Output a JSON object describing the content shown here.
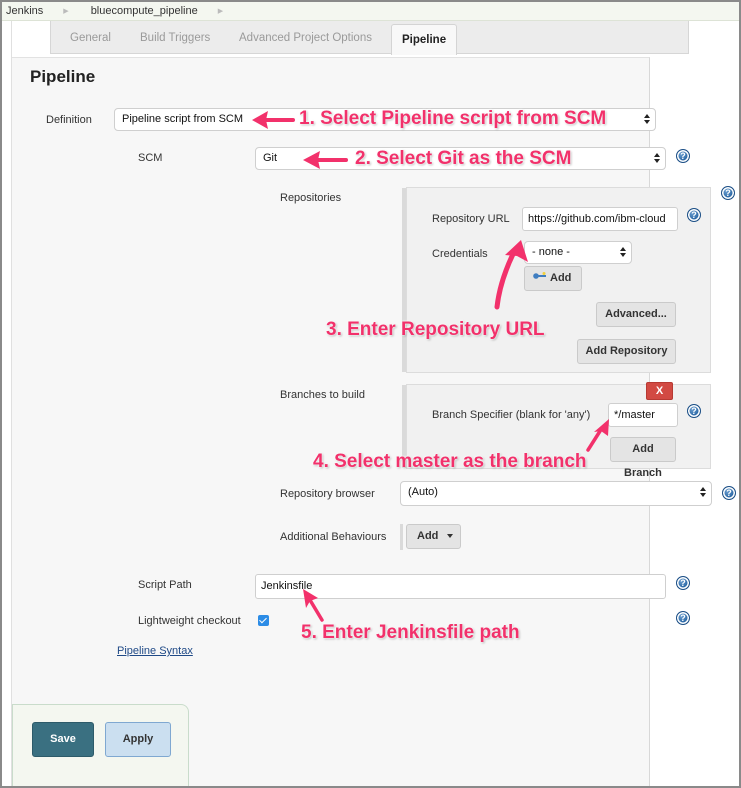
{
  "breadcrumb": {
    "items": [
      "Jenkins",
      "bluecompute_pipeline"
    ]
  },
  "tabs": [
    {
      "label": "General",
      "active": false
    },
    {
      "label": "Build Triggers",
      "active": false
    },
    {
      "label": "Advanced Project Options",
      "active": false
    },
    {
      "label": "Pipeline",
      "active": true
    }
  ],
  "section": {
    "title": "Pipeline"
  },
  "definition": {
    "label": "Definition",
    "value": "Pipeline script from SCM"
  },
  "scm": {
    "label": "SCM",
    "value": "Git"
  },
  "repositories": {
    "label": "Repositories",
    "url_label": "Repository URL",
    "url_value": "https://github.com/ibm-cloud",
    "credentials_label": "Credentials",
    "credentials_value": "- none -",
    "add_credentials_label": "Add",
    "advanced_label": "Advanced...",
    "add_repository_label": "Add Repository"
  },
  "branches": {
    "label": "Branches to build",
    "delete_label": "X",
    "specifier_label": "Branch Specifier (blank for 'any')",
    "specifier_value": "*/master",
    "add_branch_label": "Add",
    "add_branch_sublabel": "Branch"
  },
  "repo_browser": {
    "label": "Repository browser",
    "value": "(Auto)"
  },
  "additional_behaviours": {
    "label": "Additional Behaviours",
    "add_label": "Add"
  },
  "script_path": {
    "label": "Script Path",
    "value": "Jenkinsfile"
  },
  "lightweight": {
    "label": "Lightweight checkout",
    "checked": true
  },
  "pipeline_syntax_link": "Pipeline Syntax",
  "actions": {
    "save_label": "Save",
    "apply_label": "Apply"
  },
  "help_icon_glyph": "?",
  "annotations": [
    "1. Select Pipeline script from SCM",
    "2. Select Git as the SCM",
    "3. Enter Repository URL",
    "4. Select master as the branch",
    "5. Enter Jenkinsfile path"
  ],
  "colors": {
    "annotation": "#f2316b",
    "save_button": "#3a7081",
    "apply_button": "#cbdff0",
    "delete_button": "#d24a43",
    "help_icon": "#1f5e9e",
    "link": "#204a87"
  }
}
